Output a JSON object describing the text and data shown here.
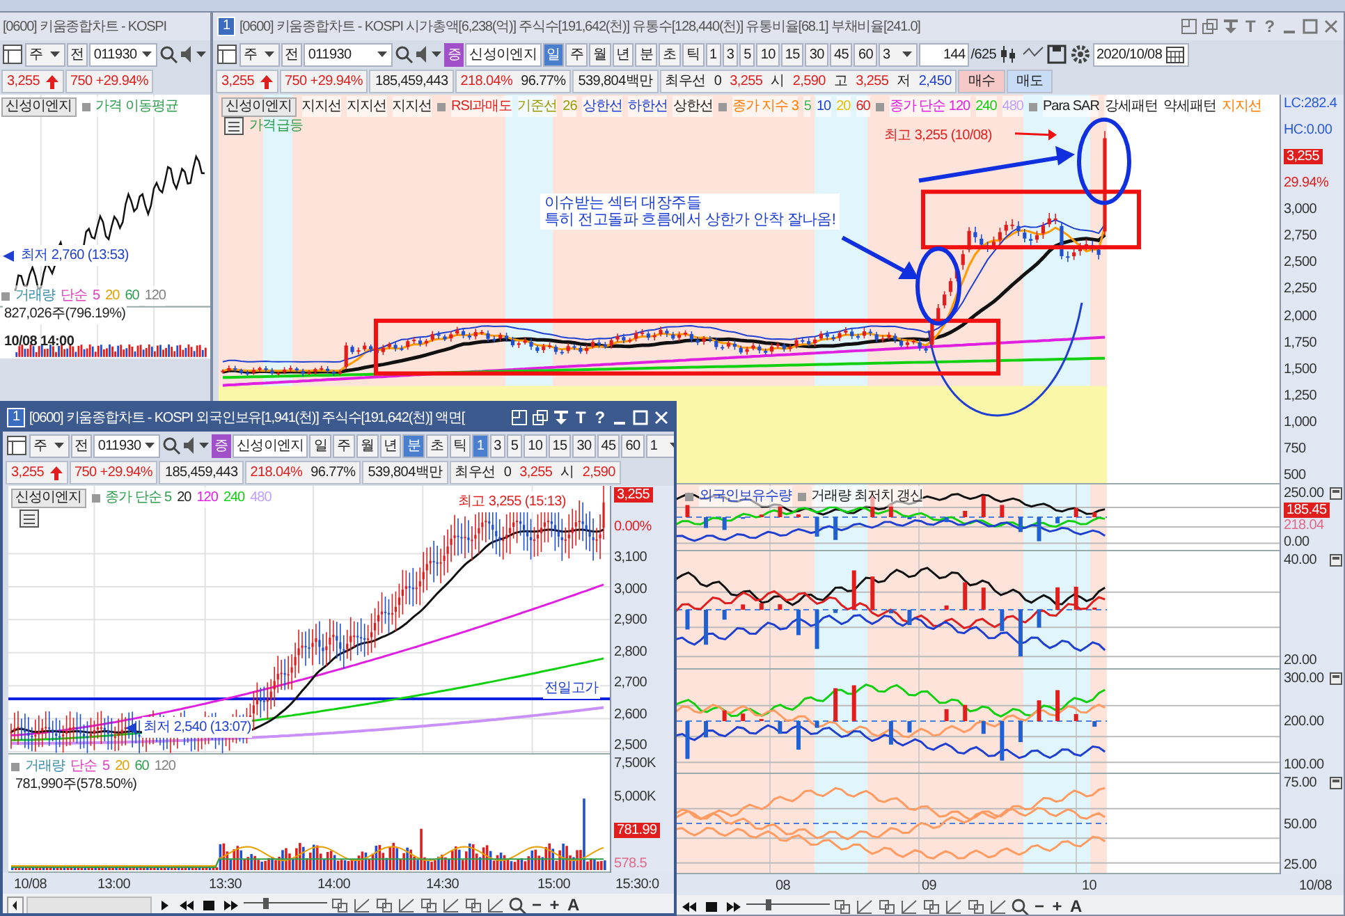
{
  "left_window": {
    "title": "[0600] 키움종합차트 - KOSPI",
    "toolbar": {
      "period": "주",
      "mode": "전",
      "code": "011930"
    },
    "quote_cells": [
      [
        {
          "text": "3,255",
          "color": "#e01e1e",
          "arrow": true
        }
      ],
      [
        {
          "text": "750 +29.94%",
          "color": "#e01e1e",
          "arrow": false
        }
      ]
    ],
    "legend": [
      {
        "text": "신성이엔지",
        "kind": "button",
        "color": "#222222"
      },
      {
        "text": "가격 이동평균",
        "kind": "bullet",
        "color": "#2e9e4e"
      }
    ],
    "low_label": "최저 2,760 (13:53)",
    "volume_legend": [
      {
        "text": "거래량",
        "kind": "bullet",
        "color": "#3a8fa8"
      },
      {
        "text": "단순",
        "kind": "text",
        "color": "#e040c0"
      },
      {
        "text": "5",
        "kind": "text",
        "color": "#e040c0"
      },
      {
        "text": "20",
        "kind": "text",
        "color": "#e0a000"
      },
      {
        "text": "60",
        "kind": "text",
        "color": "#2e9e4e"
      },
      {
        "text": "120",
        "kind": "text",
        "color": "#808080"
      }
    ],
    "volume_reading": "827,026주(796.19%)",
    "time_label": "10/08 14:00"
  },
  "main_window": {
    "number": "1",
    "title": "[0600] 키움종합차트 - KOSPI 시가총액[6,238(억)] 주식수[191,642(천)] 유통수[128,440(천)] 유통비율[68.1] 부채비율[241.0]",
    "title_glyphs": [
      "T",
      "?"
    ],
    "toolbar": {
      "period": "주",
      "mode": "전",
      "code": "011930",
      "market": "증",
      "stock": "신성이엔지",
      "periods": [
        {
          "text": "일",
          "selected": true
        },
        {
          "text": "주",
          "selected": false
        },
        {
          "text": "월",
          "selected": false
        },
        {
          "text": "년",
          "selected": false
        },
        {
          "text": "분",
          "selected": false
        },
        {
          "text": "초",
          "selected": false
        },
        {
          "text": "틱",
          "selected": false
        }
      ],
      "intervals": [
        {
          "text": "1",
          "selected": false
        },
        {
          "text": "3",
          "selected": false
        },
        {
          "text": "5",
          "selected": false
        },
        {
          "text": "10",
          "selected": false
        },
        {
          "text": "15",
          "selected": false
        },
        {
          "text": "30",
          "selected": false
        },
        {
          "text": "45",
          "selected": false
        },
        {
          "text": "60",
          "selected": false
        }
      ],
      "count": "3",
      "bars": "144",
      "total": "/625",
      "date": "2020/10/08"
    },
    "quote_cells": [
      [
        {
          "text": "3,255",
          "color": "#e01e1e",
          "arrow": true
        }
      ],
      [
        {
          "text": "750 +29.94%",
          "color": "#e01e1e",
          "arrow": false
        }
      ],
      [
        {
          "text": "185,459,443",
          "color": "#222222",
          "arrow": false
        }
      ],
      [
        {
          "text": "218.04%",
          "color": "#e01e1e",
          "arrow": false
        },
        {
          "text": "96.77%",
          "color": "#222222",
          "arrow": false
        }
      ],
      [
        {
          "text": "539,804백만",
          "color": "#222222",
          "arrow": false
        }
      ],
      [
        {
          "text": "최우선",
          "color": "#222222",
          "arrow": false
        },
        {
          "text": "0",
          "color": "#222222",
          "arrow": false
        },
        {
          "text": "3,255",
          "color": "#e01e1e",
          "arrow": false
        },
        {
          "text": "시",
          "color": "#222222",
          "arrow": false
        },
        {
          "text": "2,590",
          "color": "#e01e1e",
          "arrow": false
        },
        {
          "text": "고",
          "color": "#222222",
          "arrow": false
        },
        {
          "text": "3,255",
          "color": "#e01e1e",
          "arrow": false
        },
        {
          "text": "저",
          "color": "#222222",
          "arrow": false
        },
        {
          "text": "2,450",
          "color": "#1f3fd0",
          "arrow": false
        }
      ]
    ],
    "buttons": [
      {
        "text": "매수",
        "kind": "buy"
      },
      {
        "text": "매도",
        "kind": "sell"
      }
    ],
    "legend": [
      {
        "text": "신성이엔지",
        "kind": "button",
        "color": "#222222"
      },
      {
        "text": "지지선",
        "kind": "text",
        "color": "#222222"
      },
      {
        "text": "지지선",
        "kind": "text",
        "color": "#222222"
      },
      {
        "text": "지지선",
        "kind": "text",
        "color": "#222222"
      },
      {
        "text": "RSI과매도",
        "kind": "bullet",
        "color": "#e01e1e"
      },
      {
        "text": "기준선",
        "kind": "text",
        "color": "#9a9a00"
      },
      {
        "text": "26",
        "kind": "text",
        "color": "#9a9a00"
      },
      {
        "text": "상한선",
        "kind": "text",
        "color": "#1f3fd0"
      },
      {
        "text": "하한선",
        "kind": "text",
        "color": "#1f3fd0"
      },
      {
        "text": "상한선",
        "kind": "text",
        "color": "#222222"
      },
      {
        "text": "종가 지수 3",
        "kind": "bullet",
        "color": "#ff7a00"
      },
      {
        "text": "5",
        "kind": "text",
        "color": "#4caf50"
      },
      {
        "text": "10",
        "kind": "text",
        "color": "#1f3fd0"
      },
      {
        "text": "20",
        "kind": "text",
        "color": "#e0c000"
      },
      {
        "text": "60",
        "kind": "text",
        "color": "#e01e1e"
      },
      {
        "text": "종가 단순 120",
        "kind": "bullet",
        "color": "#e020e0"
      },
      {
        "text": "240",
        "kind": "text",
        "color": "#10d010"
      },
      {
        "text": "480",
        "kind": "text",
        "color": "#c0a0ff"
      },
      {
        "text": "Para SAR",
        "kind": "bullet",
        "color": "#222222"
      },
      {
        "text": "강세패턴",
        "kind": "text",
        "color": "#222222"
      },
      {
        "text": "약세패턴",
        "kind": "text",
        "color": "#222222"
      },
      {
        "text": "지지선",
        "kind": "text",
        "color": "#ff7a00"
      }
    ],
    "legend_line2": {
      "text": "가격급등",
      "color": "#2e9e4e"
    },
    "high_label": "최고 3,255 (10/08)",
    "note_lines": [
      "이슈받는 섹터 대장주들",
      "특히 전고돌파 흐름에서 상한가 안착 잘나옴!"
    ],
    "price_axis": [
      {
        "text": "LC:282.4",
        "kind": "note",
        "color": "#2a5ad8"
      },
      {
        "text": "HC:0.00",
        "kind": "note",
        "color": "#2a5ad8"
      },
      {
        "text": "3,255",
        "kind": "tag",
        "color": "#e01e1e"
      },
      {
        "text": "29.94%",
        "kind": "note",
        "color": "#e01e1e"
      },
      {
        "text": "3,000",
        "kind": "tick"
      },
      {
        "text": "2,750",
        "kind": "tick"
      },
      {
        "text": "2,500",
        "kind": "tick"
      },
      {
        "text": "2,250",
        "kind": "tick"
      },
      {
        "text": "2,000",
        "kind": "tick"
      },
      {
        "text": "1,750",
        "kind": "tick"
      },
      {
        "text": "1,500",
        "kind": "tick"
      },
      {
        "text": "1,250",
        "kind": "tick"
      },
      {
        "text": "1,000",
        "kind": "tick"
      },
      {
        "text": "750",
        "kind": "tick"
      },
      {
        "text": "500",
        "kind": "tick"
      }
    ],
    "panels": [
      {
        "legend": [
          {
            "text": "외국인보유수량",
            "kind": "bullet",
            "color": "#1f3fd0"
          },
          {
            "text": "거래량 최저치 갱신",
            "kind": "bullet",
            "color": "#222222"
          }
        ],
        "axis": [
          {
            "text": "250.00",
            "kind": "tick"
          },
          {
            "text": "185.45",
            "kind": "tag",
            "color": "#e01e1e"
          },
          {
            "text": "218.04",
            "kind": "note",
            "color": "#e06a8a"
          },
          {
            "text": "0.00",
            "kind": "tick"
          }
        ]
      },
      {
        "axis": [
          {
            "text": "40.00",
            "kind": "tick"
          },
          {
            "text": "20.00",
            "kind": "tick"
          }
        ]
      },
      {
        "axis": [
          {
            "text": "300.00",
            "kind": "tick"
          },
          {
            "text": "200.00",
            "kind": "tick"
          },
          {
            "text": "100.00",
            "kind": "tick"
          }
        ]
      },
      {
        "axis": [
          {
            "text": "75.00",
            "kind": "tick"
          },
          {
            "text": "50.00",
            "kind": "tick"
          },
          {
            "text": "25.00",
            "kind": "tick"
          }
        ]
      }
    ],
    "zoom_slider": {
      "level": 0.27
    },
    "x_axis": [
      "08",
      "09",
      "10"
    ],
    "x_axis_end": "10/08",
    "footer_glyphs": [
      "−",
      "+",
      "A"
    ]
  },
  "detail_window": {
    "number": "1",
    "title": "[0600] 키움종합차트 - KOSPI 외국인보유[1,941(천)] 주식수[191,642(천)] 액면[",
    "title_glyphs": [
      "T",
      "?"
    ],
    "toolbar": {
      "period": "주",
      "mode": "전",
      "code": "011930",
      "market": "증",
      "stock": "신성이엔지",
      "periods": [
        {
          "text": "일",
          "selected": false
        },
        {
          "text": "주",
          "selected": false
        },
        {
          "text": "월",
          "selected": false
        },
        {
          "text": "년",
          "selected": false
        },
        {
          "text": "분",
          "selected": true
        },
        {
          "text": "초",
          "selected": false
        },
        {
          "text": "틱",
          "selected": false
        }
      ],
      "intervals": [
        {
          "text": "1",
          "selected": true
        },
        {
          "text": "3",
          "selected": false
        },
        {
          "text": "5",
          "selected": false
        },
        {
          "text": "10",
          "selected": false
        },
        {
          "text": "15",
          "selected": false
        },
        {
          "text": "30",
          "selected": false
        },
        {
          "text": "45",
          "selected": false
        },
        {
          "text": "60",
          "selected": false
        }
      ],
      "count": "1"
    },
    "quote_cells": [
      [
        {
          "text": "3,255",
          "color": "#e01e1e",
          "arrow": true
        }
      ],
      [
        {
          "text": "750 +29.94%",
          "color": "#e01e1e",
          "arrow": false
        }
      ],
      [
        {
          "text": "185,459,443",
          "color": "#222222",
          "arrow": false
        }
      ],
      [
        {
          "text": "218.04%",
          "color": "#e01e1e",
          "arrow": false
        },
        {
          "text": "96.77%",
          "color": "#222222",
          "arrow": false
        }
      ],
      [
        {
          "text": "539,804백만",
          "color": "#222222",
          "arrow": false
        }
      ],
      [
        {
          "text": "최우선",
          "color": "#222222",
          "arrow": false
        },
        {
          "text": "0",
          "color": "#222222",
          "arrow": false
        },
        {
          "text": "3,255",
          "color": "#e01e1e",
          "arrow": false
        },
        {
          "text": "시",
          "color": "#222222",
          "arrow": false
        },
        {
          "text": "2,590",
          "color": "#e01e1e",
          "arrow": false
        }
      ]
    ],
    "legend": [
      {
        "text": "신성이엔지",
        "kind": "button",
        "color": "#222222"
      },
      {
        "text": "종가 단순 5",
        "kind": "bullet",
        "color": "#2e9e4e"
      },
      {
        "text": "20",
        "kind": "text",
        "color": "#222222"
      },
      {
        "text": "120",
        "kind": "text",
        "color": "#e020e0"
      },
      {
        "text": "240",
        "kind": "text",
        "color": "#10d010"
      },
      {
        "text": "480",
        "kind": "text",
        "color": "#c0a0ff"
      }
    ],
    "high_label": "최고 3,255 (15:13)",
    "prev_high_label": "전일고가",
    "low_label": "최저 2,540 (13:07)",
    "price_axis": [
      {
        "text": "3,255",
        "kind": "tag",
        "color": "#e01e1e"
      },
      {
        "text": "0.00%",
        "kind": "note",
        "color": "#e01e1e"
      },
      {
        "text": "3,100",
        "kind": "tick"
      },
      {
        "text": "3,000",
        "kind": "tick"
      },
      {
        "text": "2,900",
        "kind": "tick"
      },
      {
        "text": "2,800",
        "kind": "tick"
      },
      {
        "text": "2,700",
        "kind": "tick"
      },
      {
        "text": "2,600",
        "kind": "tick"
      },
      {
        "text": "2,500",
        "kind": "tick"
      }
    ],
    "volume_legend": [
      {
        "text": "거래량",
        "kind": "bullet",
        "color": "#3a8fa8"
      },
      {
        "text": "단순",
        "kind": "text",
        "color": "#e040c0"
      },
      {
        "text": "5",
        "kind": "text",
        "color": "#e040c0"
      },
      {
        "text": "20",
        "kind": "text",
        "color": "#e0a000"
      },
      {
        "text": "60",
        "kind": "text",
        "color": "#2e9e4e"
      },
      {
        "text": "120",
        "kind": "text",
        "color": "#808080"
      }
    ],
    "volume_reading": "781,990주(578.50%)",
    "volume_axis": [
      {
        "text": "7,500K",
        "kind": "tick"
      },
      {
        "text": "5,000K",
        "kind": "tick"
      },
      {
        "text": "781.99",
        "kind": "tag",
        "color": "#e01e1e"
      },
      {
        "text": "578.5",
        "kind": "note",
        "color": "#e06a8a"
      }
    ],
    "zoom_slider": {
      "level": 0.27
    },
    "x_axis": [
      "10/08",
      "13:00",
      "13:30",
      "14:00",
      "14:30",
      "15:00"
    ],
    "x_axis_end": "15:30:0",
    "footer_glyphs": [
      "−",
      "+",
      "A"
    ]
  }
}
